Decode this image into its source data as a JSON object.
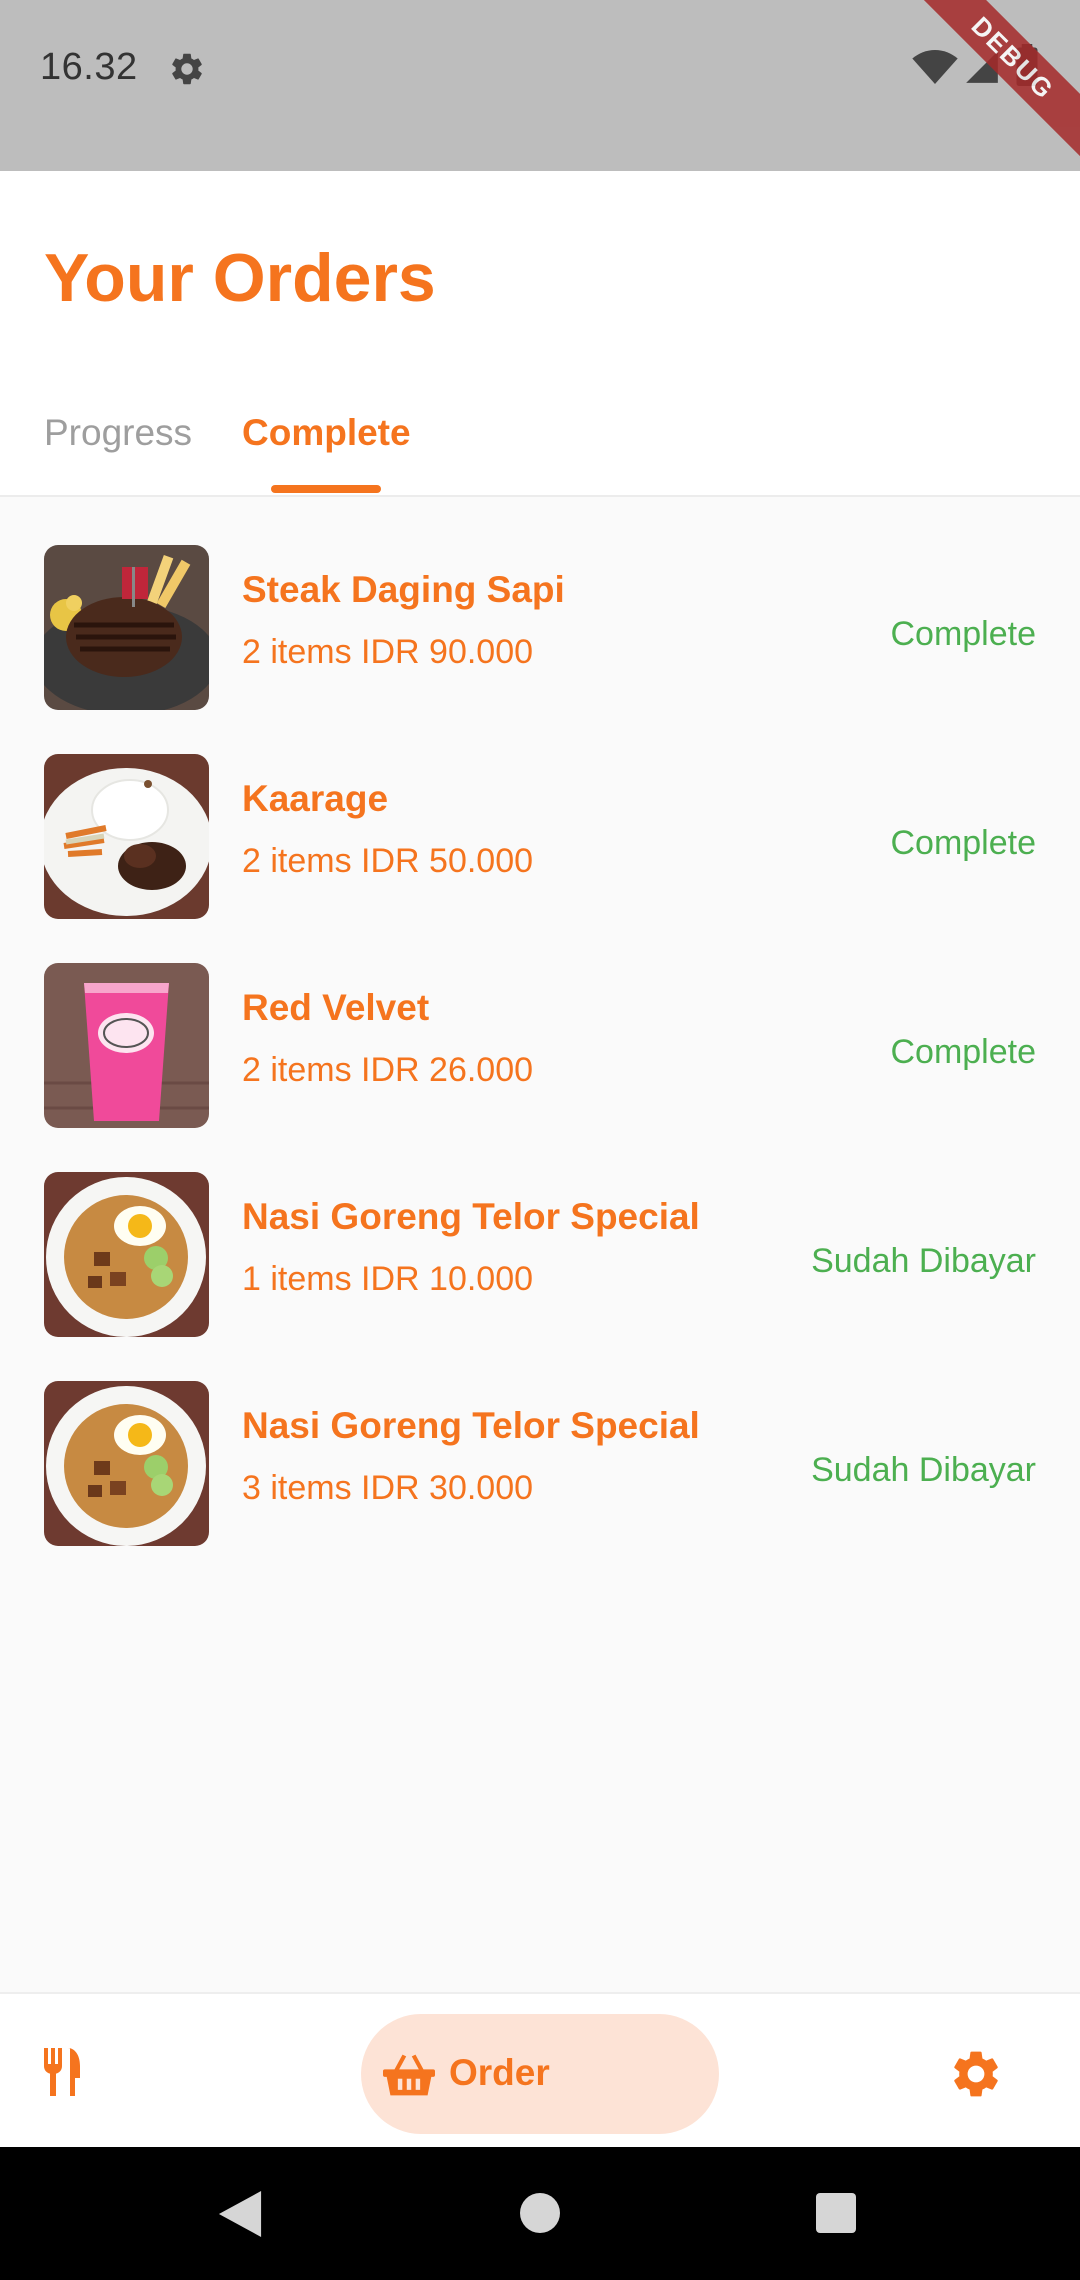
{
  "status_bar": {
    "time": "16.32",
    "debug_label": "DEBUG",
    "icons": [
      "gear-icon",
      "wifi-icon",
      "signal-icon",
      "battery-icon"
    ]
  },
  "header": {
    "title": "Your Orders"
  },
  "tabs": [
    {
      "label": "Progress",
      "active": false
    },
    {
      "label": "Complete",
      "active": true
    }
  ],
  "orders": [
    {
      "name": "Steak Daging Sapi",
      "meta": "2 items IDR 90.000",
      "status": "Complete",
      "thumbnail": "steak-photo"
    },
    {
      "name": "Kaarage",
      "meta": "2 items IDR 50.000",
      "status": "Complete",
      "thumbnail": "karaage-photo"
    },
    {
      "name": "Red Velvet",
      "meta": "2 items IDR 26.000",
      "status": "Complete",
      "thumbnail": "red-velvet-drink-photo"
    },
    {
      "name": "Nasi Goreng Telor Special",
      "meta": "1 items IDR 10.000",
      "status": "Sudah Dibayar",
      "thumbnail": "nasi-goreng-photo"
    },
    {
      "name": "Nasi Goreng Telor Special",
      "meta": "3 items IDR 30.000",
      "status": "Sudah Dibayar",
      "thumbnail": "nasi-goreng-photo"
    }
  ],
  "bottom_nav": {
    "items": [
      {
        "icon": "utensils-icon",
        "label": ""
      },
      {
        "icon": "basket-icon",
        "label": "Order",
        "active": true
      },
      {
        "icon": "settings-icon",
        "label": ""
      }
    ]
  },
  "colors": {
    "accent": "#f5741e",
    "accent_soft": "#fde3d6",
    "status_green": "#4caf50",
    "inactive_tab": "#9e9e9e",
    "status_bar_bg": "#bdbdbd"
  }
}
